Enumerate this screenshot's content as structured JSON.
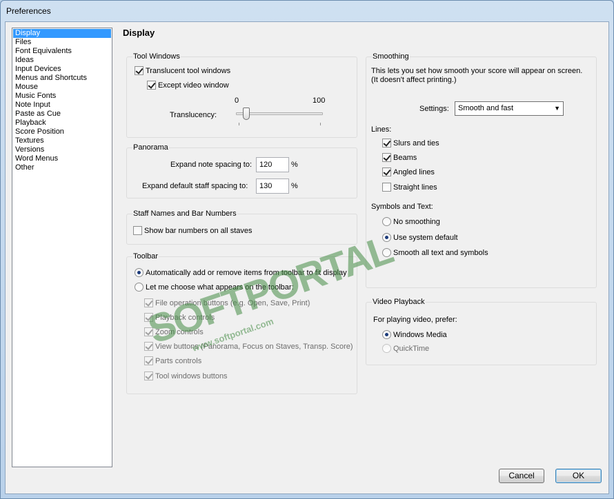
{
  "window": {
    "title": "Preferences"
  },
  "nav": {
    "items": [
      "Display",
      "Files",
      "Font Equivalents",
      "Ideas",
      "Input Devices",
      "Menus and Shortcuts",
      "Mouse",
      "Music Fonts",
      "Note Input",
      "Paste as Cue",
      "Playback",
      "Score Position",
      "Textures",
      "Versions",
      "Word Menus",
      "Other"
    ],
    "selected": "Display"
  },
  "page": {
    "heading": "Display"
  },
  "tool_windows": {
    "title": "Tool Windows",
    "translucent": {
      "label": "Translucent tool windows",
      "checked": true
    },
    "except_video": {
      "label": "Except video window",
      "checked": true
    },
    "slider_min": "0",
    "slider_max": "100",
    "translucency_label": "Translucency:",
    "translucency_value": 15
  },
  "panorama": {
    "title": "Panorama",
    "note_spacing_label": "Expand note spacing to:",
    "note_spacing_value": "120",
    "staff_spacing_label": "Expand default staff spacing to:",
    "staff_spacing_value": "130",
    "unit": "%"
  },
  "staff_names": {
    "title": "Staff Names and Bar Numbers",
    "show_bar_numbers": {
      "label": "Show bar numbers on all staves",
      "checked": false
    }
  },
  "toolbar": {
    "title": "Toolbar",
    "auto_label": "Automatically add or remove items from toolbar to fit display",
    "choose_label": "Let me choose what appears on the toolbar:",
    "items": [
      "File operation buttons (e.g. Open, Save, Print)",
      "Playback controls",
      "Zoom controls",
      "View buttons (Panorama, Focus on Staves, Transp. Score)",
      "Parts controls",
      "Tool windows buttons"
    ]
  },
  "smoothing": {
    "title": "Smoothing",
    "description_line1": "This lets you set how smooth your score will appear on screen.",
    "description_line2": "(It doesn't affect printing.)",
    "settings_label": "Settings:",
    "settings_value": "Smooth and fast",
    "lines_label": "Lines:",
    "lines": [
      {
        "label": "Slurs and ties",
        "checked": true
      },
      {
        "label": "Beams",
        "checked": true
      },
      {
        "label": "Angled lines",
        "checked": true
      },
      {
        "label": "Straight lines",
        "checked": false
      }
    ],
    "symbols_label": "Symbols and Text:",
    "symbols": [
      {
        "label": "No smoothing",
        "checked": false
      },
      {
        "label": "Use system default",
        "checked": true
      },
      {
        "label": "Smooth all text and symbols",
        "checked": false
      }
    ]
  },
  "video": {
    "title": "Video Playback",
    "prefer_label": "For playing video, prefer:",
    "options": [
      {
        "label": "Windows Media",
        "checked": true,
        "enabled": true
      },
      {
        "label": "QuickTime",
        "checked": false,
        "enabled": false
      }
    ]
  },
  "buttons": {
    "cancel": "Cancel",
    "ok": "OK"
  },
  "watermark": {
    "brand": "SOFTPORTAL",
    "url": "www.softportal.com"
  }
}
